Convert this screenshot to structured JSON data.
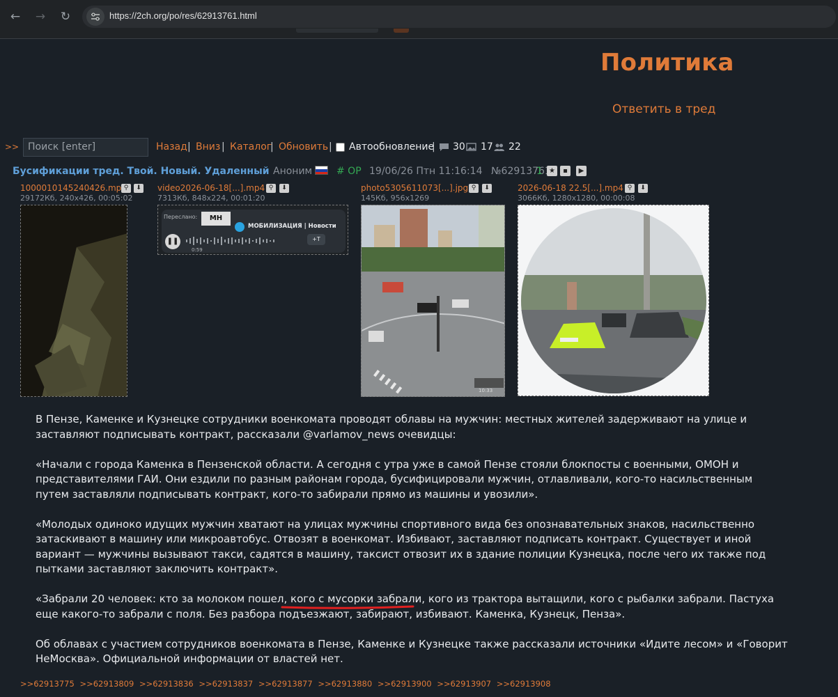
{
  "browser": {
    "url_host": "https://2ch.org",
    "url_path": "/po/res/62913761.html",
    "nav_back": "←",
    "nav_forward": "→",
    "nav_reload": "↻"
  },
  "board": {
    "title": "Политика",
    "reply_label": "Ответить в тред"
  },
  "toolbar": {
    "arrows": ">>",
    "search_placeholder": "Поиск [enter]",
    "links": [
      "Назад",
      "Вниз",
      "Каталог",
      "Обновить"
    ],
    "separator": "|",
    "autoupdate_label": "Автообновление",
    "autoupdate_checked": false,
    "posts_count": "30",
    "images_count": "17",
    "posters_count": "22"
  },
  "post": {
    "subject": "Бусификации тред. Твой. Новый. Удаленный",
    "author": "Аноним",
    "flag": "russia-flag",
    "op_label": "# OP",
    "date": "19/06/26 Птн 11:16:14",
    "number": "№62913761",
    "count": "1",
    "files": [
      {
        "name": "1000010145240426.mp4",
        "info": "29172Кб, 240x426, 00:05:02"
      },
      {
        "name": "video2026-06-18[...].mp4",
        "info": "7313Кб, 848x224, 00:01:20"
      },
      {
        "name": "photo5305611073[...].jpg",
        "info": "145Кб, 956x1269"
      },
      {
        "name": "2026-06-18 22.5[...].mp4",
        "info": "3066Кб, 1280x1280, 00:00:08"
      }
    ],
    "thumb2": {
      "forwarded": "Переслано:",
      "channel": "МОБИЛИЗАЦИЯ | Новости",
      "time": "0:59",
      "button": "+T"
    },
    "thumb3_time": "10:33",
    "paragraphs": [
      "В Пензе, Каменке и Кузнецке сотрудники военкомата проводят облавы на мужчин: местных жителей задерживают на улице и заставляют подписывать контракт, рассказали @varlamov_news очевидцы:",
      "«Начали с города Каменка в Пензенской области. А сегодня с утра уже в самой Пензе стояли блокпосты с военными, ОМОН и представителями ГАИ. Они ездили по разным районам города, бусифицировали мужчин, отлавливали, кого-то насильственным путем заставляли подписывать контракт, кого-то забирали прямо из машины и увозили».",
      "«Молодых одиноко идущих мужчин хватают на улицах мужчины спортивного вида без опознавательных знаков, насильственно затаскивают в машину или микроавтобус. Отвозят в военкомат. Избивают, заставляют подписать контракт. Существует и иной вариант — мужчины вызывают такси, садятся в машину, таксист отвозит их в здание полиции Кузнецка, после чего их также под пытками заставляют заключить контракт».",
      "«Забрали 20 человек: кто за молоком пошел, кого с мусорки забрали, кого из трактора вытащили, кого с рыбалки забрали. Пастуха еще какого-то забрали с поля. Без разбора подъезжают, забирают, избивают. Каменка, Кузнецк, Пенза».",
      "Об облавах с участием сотрудников военкомата в Пензе, Каменке и Кузнецке также рассказали источники «Идите лесом» и «Говорит НеМосква». Официальной информации от властей нет."
    ],
    "replies": [
      ">>62913775",
      ">>62913809",
      ">>62913836",
      ">>62913837",
      ">>62913877",
      ">>62913880",
      ">>62913900",
      ">>62913907",
      ">>62913908"
    ]
  },
  "colors": {
    "background": "#1a2027",
    "accent": "#e07b39",
    "subject": "#5f9fd8",
    "op": "#34a853",
    "underline": "#e02020"
  }
}
